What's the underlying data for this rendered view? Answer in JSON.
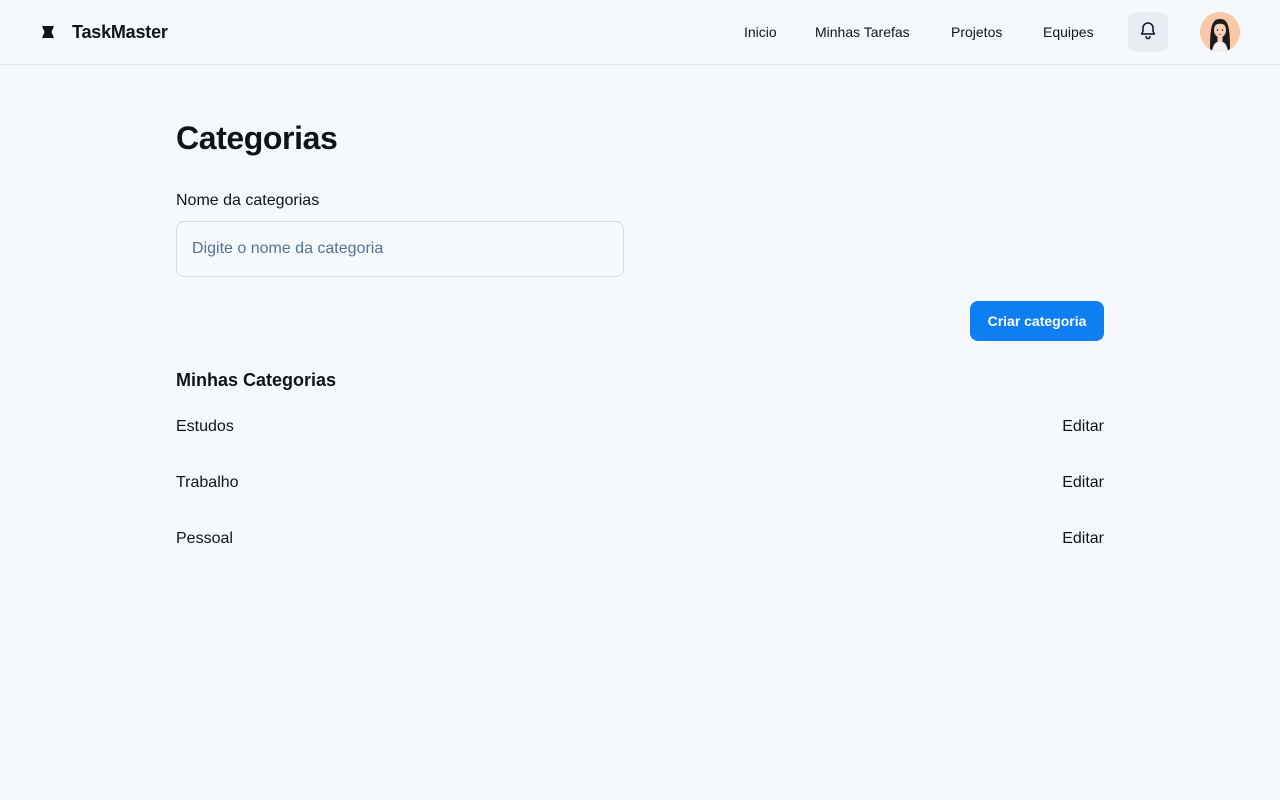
{
  "app": {
    "name": "TaskMaster",
    "logo_icon": "taskmaster-logo-icon"
  },
  "nav": {
    "items": [
      {
        "label": "Inicio"
      },
      {
        "label": "Minhas Tarefas"
      },
      {
        "label": "Projetos"
      },
      {
        "label": "Equipes"
      }
    ],
    "notification_icon": "bell-icon",
    "avatar_icon": "user-avatar"
  },
  "page": {
    "title": "Categorias"
  },
  "form": {
    "label": "Nome da categorias",
    "placeholder": "Digite o nome da categoria",
    "value": "",
    "submit_label": "Criar categoria"
  },
  "categories": {
    "title": "Minhas Categorias",
    "items": [
      {
        "name": "Estudos",
        "action": "Editar"
      },
      {
        "name": "Trabalho",
        "action": "Editar"
      },
      {
        "name": "Pessoal",
        "action": "Editar"
      }
    ]
  },
  "colors": {
    "background": "#f6f9fc",
    "primary": "#0d7ff2",
    "text": "#0f141a",
    "placeholder": "#52729a",
    "border": "#d1dbe6"
  }
}
